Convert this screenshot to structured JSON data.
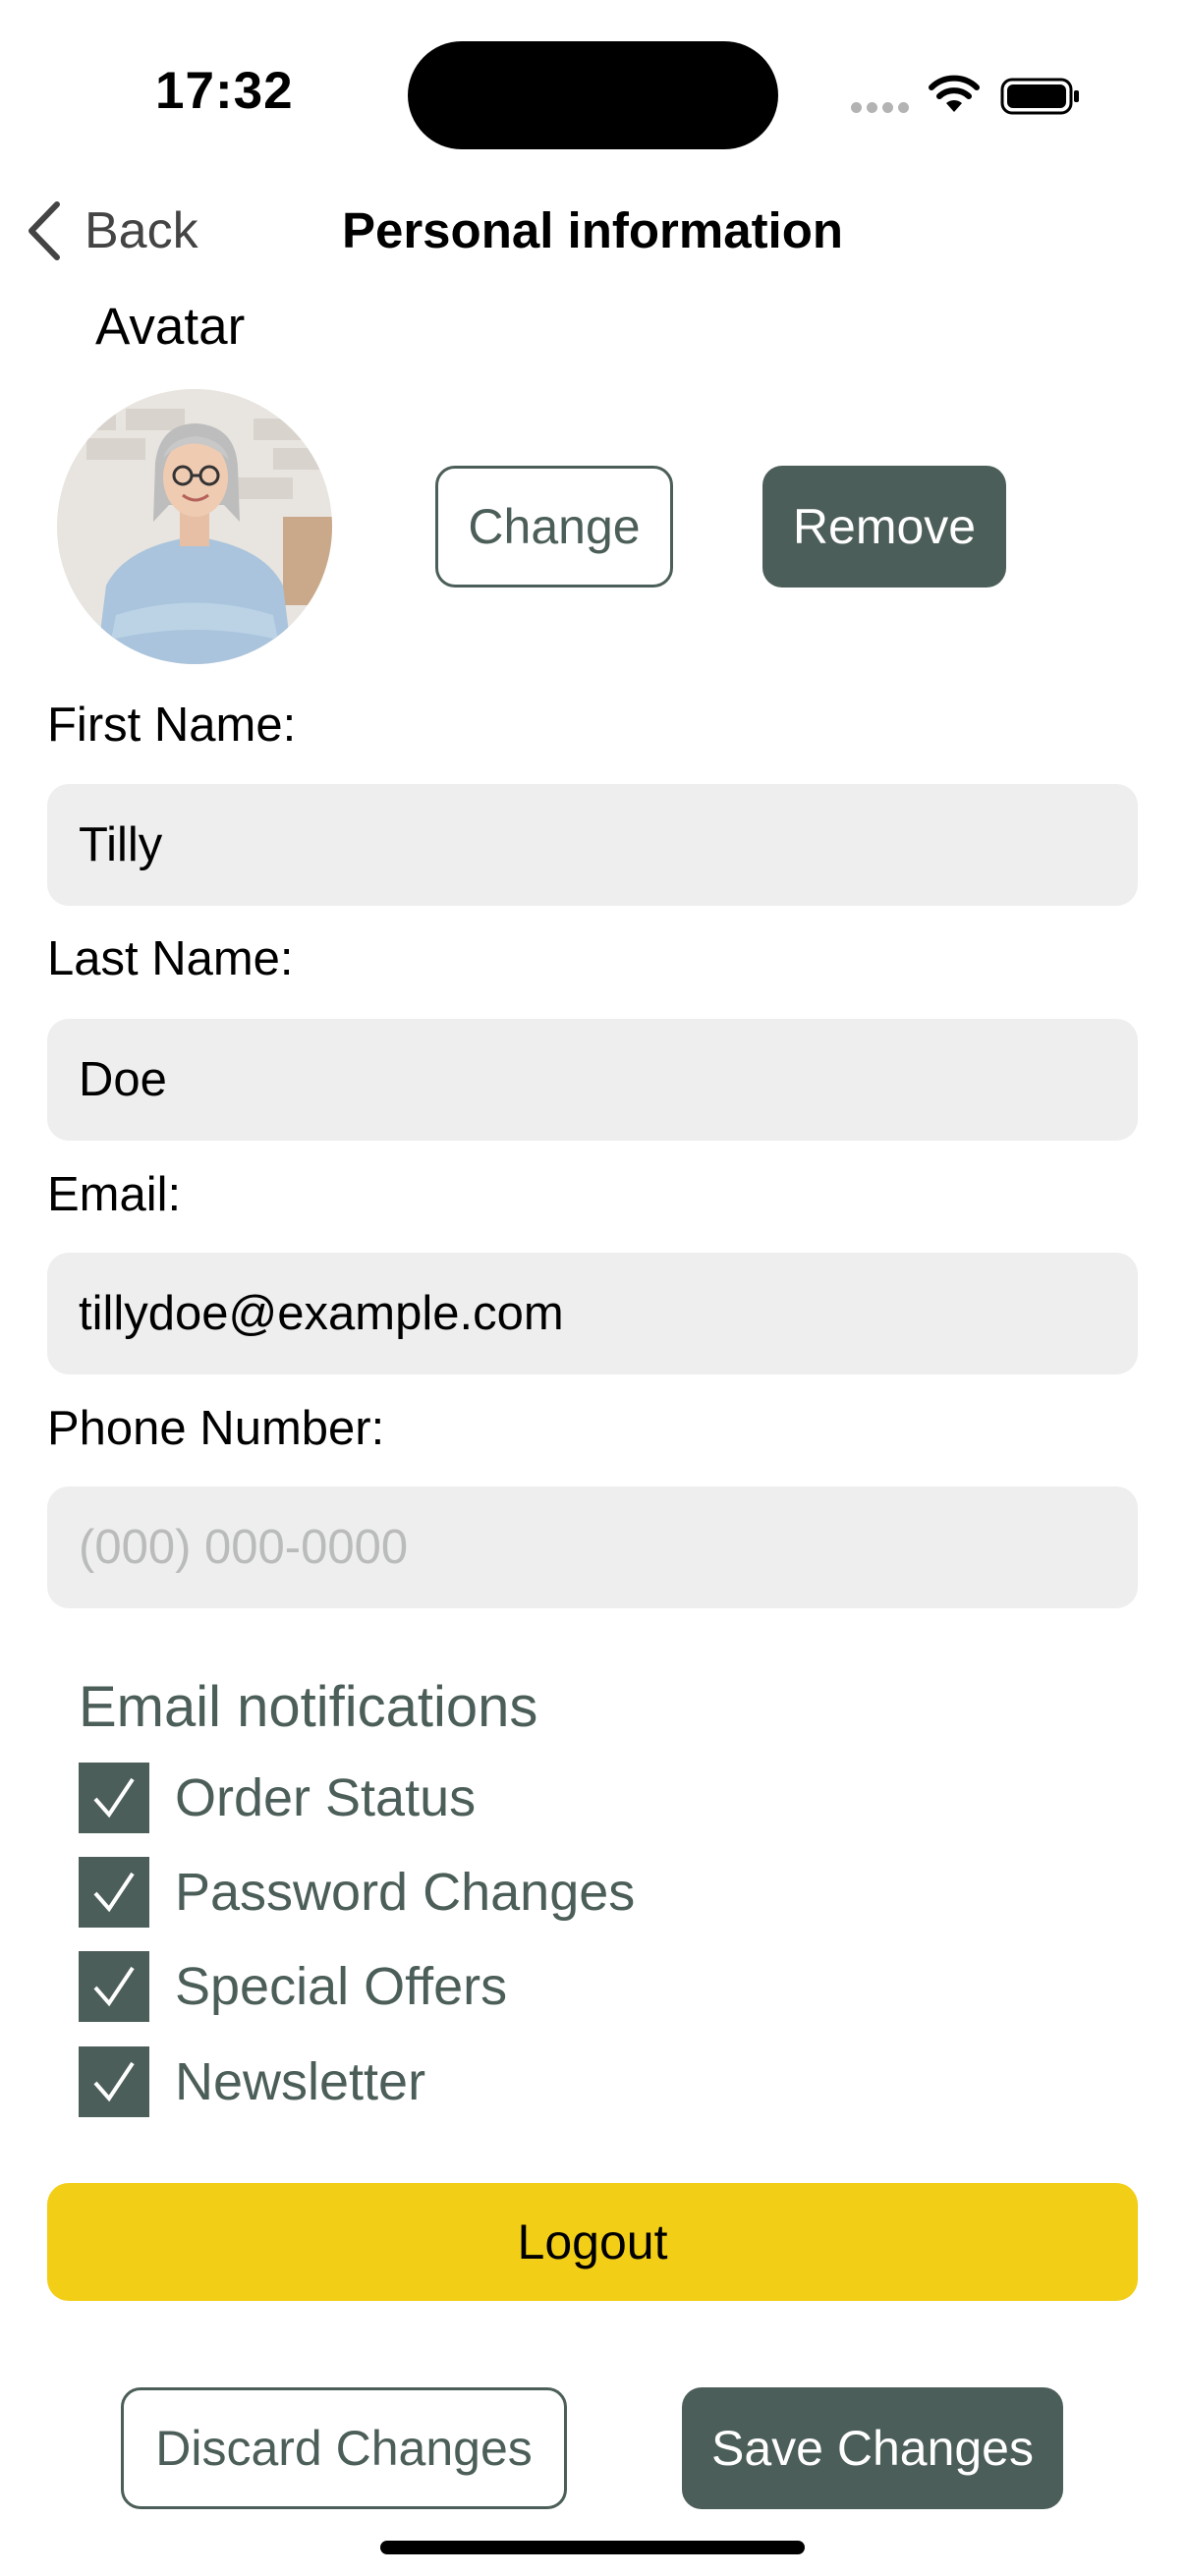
{
  "status_bar": {
    "time": "17:32"
  },
  "nav": {
    "back_label": "Back",
    "title": "Personal information"
  },
  "avatar": {
    "label": "Avatar",
    "change_label": "Change",
    "remove_label": "Remove"
  },
  "fields": {
    "first_name": {
      "label": "First Name:",
      "value": "Tilly"
    },
    "last_name": {
      "label": "Last Name:",
      "value": "Doe"
    },
    "email": {
      "label": "Email:",
      "value": "tillydoe@example.com"
    },
    "phone": {
      "label": "Phone Number:",
      "value": "",
      "placeholder": "(000) 000-0000"
    }
  },
  "notifications": {
    "heading": "Email notifications",
    "items": [
      {
        "label": "Order Status",
        "checked": true
      },
      {
        "label": "Password Changes",
        "checked": true
      },
      {
        "label": "Special Offers",
        "checked": true
      },
      {
        "label": "Newsletter",
        "checked": true
      }
    ]
  },
  "actions": {
    "logout": "Logout",
    "discard": "Discard Changes",
    "save": "Save Changes"
  },
  "colors": {
    "accent": "#4c5e59",
    "logout": "#f2ce17",
    "field_bg": "#edeeed"
  }
}
